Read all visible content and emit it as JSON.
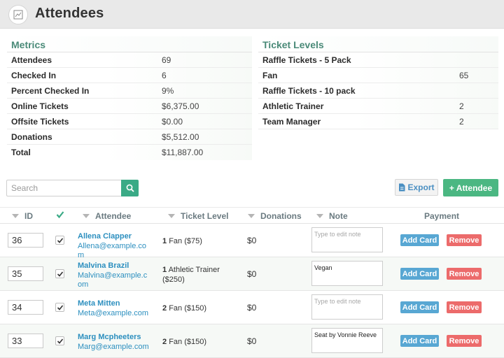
{
  "header": {
    "title": "Attendees",
    "icon": "chart-icon"
  },
  "metrics": {
    "title": "Metrics",
    "rows": [
      {
        "label": "Attendees",
        "value": "69"
      },
      {
        "label": "Checked In",
        "value": "6"
      },
      {
        "label": "Percent Checked In",
        "value": "9%"
      },
      {
        "label": "Online Tickets",
        "value": "$6,375.00"
      },
      {
        "label": "Offsite Tickets",
        "value": "$0.00"
      },
      {
        "label": "Donations",
        "value": "$5,512.00"
      },
      {
        "label": "Total",
        "value": "$11,887.00"
      }
    ]
  },
  "ticket_levels": {
    "title": "Ticket Levels",
    "rows": [
      {
        "label": "Raffle Tickets - 5 Pack",
        "value": ""
      },
      {
        "label": "Fan",
        "value": "65"
      },
      {
        "label": "Raffle Tickets - 10 pack",
        "value": ""
      },
      {
        "label": "Athletic Trainer",
        "value": "2"
      },
      {
        "label": "Team Manager",
        "value": "2"
      }
    ]
  },
  "toolbar": {
    "search_placeholder": "Search",
    "export_label": "Export",
    "add_attendee_label": "+ Attendee",
    "accent_color": "#3aaa86"
  },
  "table": {
    "columns": {
      "id": "ID",
      "attendee": "Attendee",
      "ticket_level": "Ticket Level",
      "donations": "Donations",
      "note": "Note",
      "payment": "Payment"
    },
    "rows": [
      {
        "id": "36",
        "checked": true,
        "name": "Allena Clapper",
        "email": "Allena@example.com",
        "qty": "1",
        "ticket": "Fan ($75)",
        "donation": "$0",
        "note": "",
        "note_placeholder": "Type to edit note",
        "add_card": "Add Card",
        "remove": "Remove"
      },
      {
        "id": "35",
        "checked": true,
        "name": "Malvina Brazil",
        "email": "Malvina@example.com",
        "qty": "1",
        "ticket": "Athletic Trainer ($250)",
        "donation": "$0",
        "note": "Vegan",
        "note_placeholder": "Type to edit note",
        "add_card": "Add Card",
        "remove": "Remove"
      },
      {
        "id": "34",
        "checked": true,
        "name": "Meta Mitten",
        "email": "Meta@example.com",
        "qty": "2",
        "ticket": "Fan ($150)",
        "donation": "$0",
        "note": "",
        "note_placeholder": "Type to edit note",
        "add_card": "Add Card",
        "remove": "Remove"
      },
      {
        "id": "33",
        "checked": true,
        "name": "Marg Mcpheeters",
        "email": "Marg@example.com",
        "qty": "2",
        "ticket": "Fan ($150)",
        "donation": "$0",
        "note": "Seat by Vonnie Reeve",
        "note_placeholder": "Type to edit note",
        "add_card": "Add Card",
        "remove": "Remove"
      }
    ]
  }
}
